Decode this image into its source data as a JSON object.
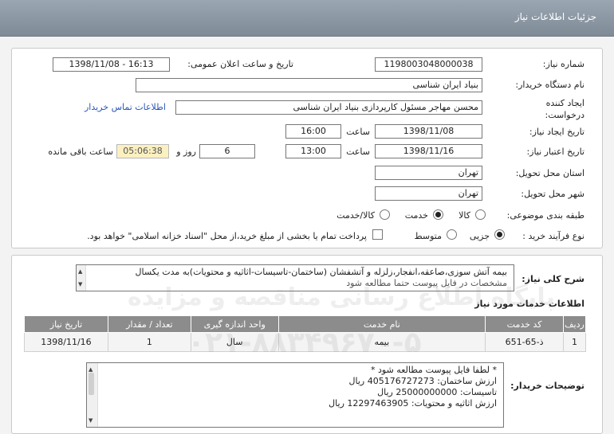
{
  "header": {
    "title": "جزئیات اطلاعات نیاز"
  },
  "form": {
    "need_number_label": "شماره نیاز:",
    "need_number": "1198003048000038",
    "announce_label": "تاریخ و ساعت اعلان عمومی:",
    "announce_value": "1398/11/08 - 16:13",
    "buyer_org_label": "نام دستگاه خریدار:",
    "buyer_org": "بنیاد ایران شناسی",
    "requester_label": "ایجاد کننده درخواست:",
    "requester": "محسن  مهاجر مسئول کارپردازی  بنیاد ایران شناسی",
    "contact_link": "اطلاعات تماس خریدار",
    "created_label": "تاریخ ایجاد نیاز:",
    "created_date": "1398/11/08",
    "time_label": "ساعت",
    "created_time": "16:00",
    "valid_label": "تاریخ اعتبار نیاز:",
    "valid_date": "1398/11/16",
    "valid_time": "13:00",
    "days": "6",
    "days_label": "روز و",
    "remaining": "05:06:38",
    "remaining_label": "ساعت باقی مانده",
    "province_label": "استان محل تحویل:",
    "province": "تهران",
    "city_label": "شهر محل تحویل:",
    "city": "تهران",
    "category_label": "طبقه بندی موضوعی:",
    "category_options": [
      "کالا",
      "خدمت",
      "کالا/خدمت"
    ],
    "category_selected": "خدمت",
    "process_label": "نوع فرآیند خرید :",
    "process_options": [
      "جزیی",
      "متوسط"
    ],
    "process_selected": "جزیی",
    "payment_note": "پرداخت تمام یا بخشی از مبلغ خرید،از محل \"اسناد خزانه اسلامی\" خواهد بود."
  },
  "description": {
    "label": "شرح کلی نیاز:",
    "text_line1": "بیمه آتش سوزی،صاعقه،انفجار،زلزله و آتشفشان (ساختمان-تاسیسات-اثاثیه و محتویات)به مدت یکسال",
    "text_line2": "مشخصات در فایل پیوست حتما مطالعه شود"
  },
  "services": {
    "title": "اطلاعات خدمات مورد نیاز",
    "columns": [
      "ردیف",
      "کد خدمت",
      "نام خدمت",
      "واحد اندازه گیری",
      "تعداد / مقدار",
      "تاریخ نیاز"
    ],
    "rows": [
      [
        "1",
        "ذ-65-651",
        "بیمه",
        "سال",
        "1",
        "1398/11/16"
      ]
    ]
  },
  "buyer_notes": {
    "label": "توضیحات خریدار:",
    "lines": [
      "* لطفا فایل پیوست مطالعه شود *",
      "ارزش ساختمان: 405176727273 ریال",
      "تاسیسات: 25000000000 ریال",
      "ارزش اثاثیه و محتویات: 12297463905 ریال"
    ]
  },
  "watermark": {
    "line1": "پایگاه اطلاع رسانی مناقصه و مزایده",
    "line2": "۰۲۱-۸۸۳۴۹۶۷۰-۵"
  }
}
